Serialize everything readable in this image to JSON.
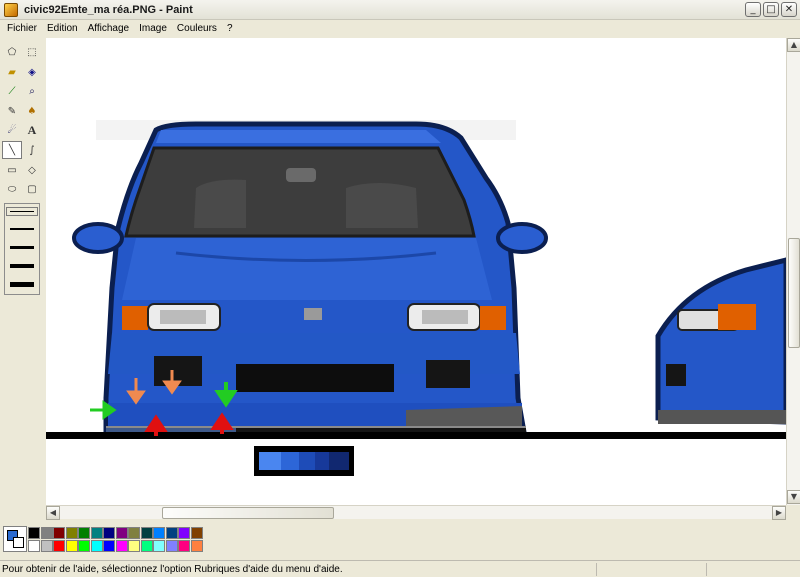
{
  "window": {
    "title": "civic92Emte_ma réa.PNG - Paint"
  },
  "window_buttons": {
    "minimize": "_",
    "maximize": "□",
    "close": "✕"
  },
  "menu": [
    "Fichier",
    "Edition",
    "Affichage",
    "Image",
    "Couleurs",
    "?"
  ],
  "tools": [
    {
      "name": "free-select-icon",
      "glyph": "⬠"
    },
    {
      "name": "rect-select-icon",
      "glyph": "⬚"
    },
    {
      "name": "eraser-icon",
      "glyph": "▰"
    },
    {
      "name": "fill-icon",
      "glyph": "◈"
    },
    {
      "name": "picker-icon",
      "glyph": "⟋"
    },
    {
      "name": "magnifier-icon",
      "glyph": "⌕"
    },
    {
      "name": "pencil-icon",
      "glyph": "✎"
    },
    {
      "name": "brush-icon",
      "glyph": "♠"
    },
    {
      "name": "airbrush-icon",
      "glyph": "☄"
    },
    {
      "name": "text-icon",
      "glyph": "A"
    },
    {
      "name": "line-icon",
      "glyph": "╲"
    },
    {
      "name": "curve-icon",
      "glyph": "∫"
    },
    {
      "name": "rectangle-icon",
      "glyph": "▭"
    },
    {
      "name": "polygon-icon",
      "glyph": "◇"
    },
    {
      "name": "ellipse-icon",
      "glyph": "⬭"
    },
    {
      "name": "rounded-rect-icon",
      "glyph": "▢"
    }
  ],
  "colors": {
    "current_fg": "#2a6ad0",
    "current_bg": "#ffffff",
    "palette_top": [
      "#000000",
      "#808080",
      "#800000",
      "#808000",
      "#008000",
      "#008080",
      "#000080",
      "#800080",
      "#808040",
      "#004040",
      "#0080ff",
      "#004080",
      "#8000ff",
      "#804000"
    ],
    "palette_bottom": [
      "#ffffff",
      "#c0c0c0",
      "#ff0000",
      "#ffff00",
      "#00ff00",
      "#00ffff",
      "#0000ff",
      "#ff00ff",
      "#ffff80",
      "#00ff80",
      "#80ffff",
      "#8080ff",
      "#ff0080",
      "#ff8040"
    ],
    "car_body": "#2457c8",
    "arrow_green": "#22cc22",
    "arrow_orange": "#f08a50",
    "arrow_red": "#e01010"
  },
  "status": {
    "text": "Pour obtenir de l'aide, sélectionnez l'option Rubriques d'aide du menu d'aide."
  }
}
